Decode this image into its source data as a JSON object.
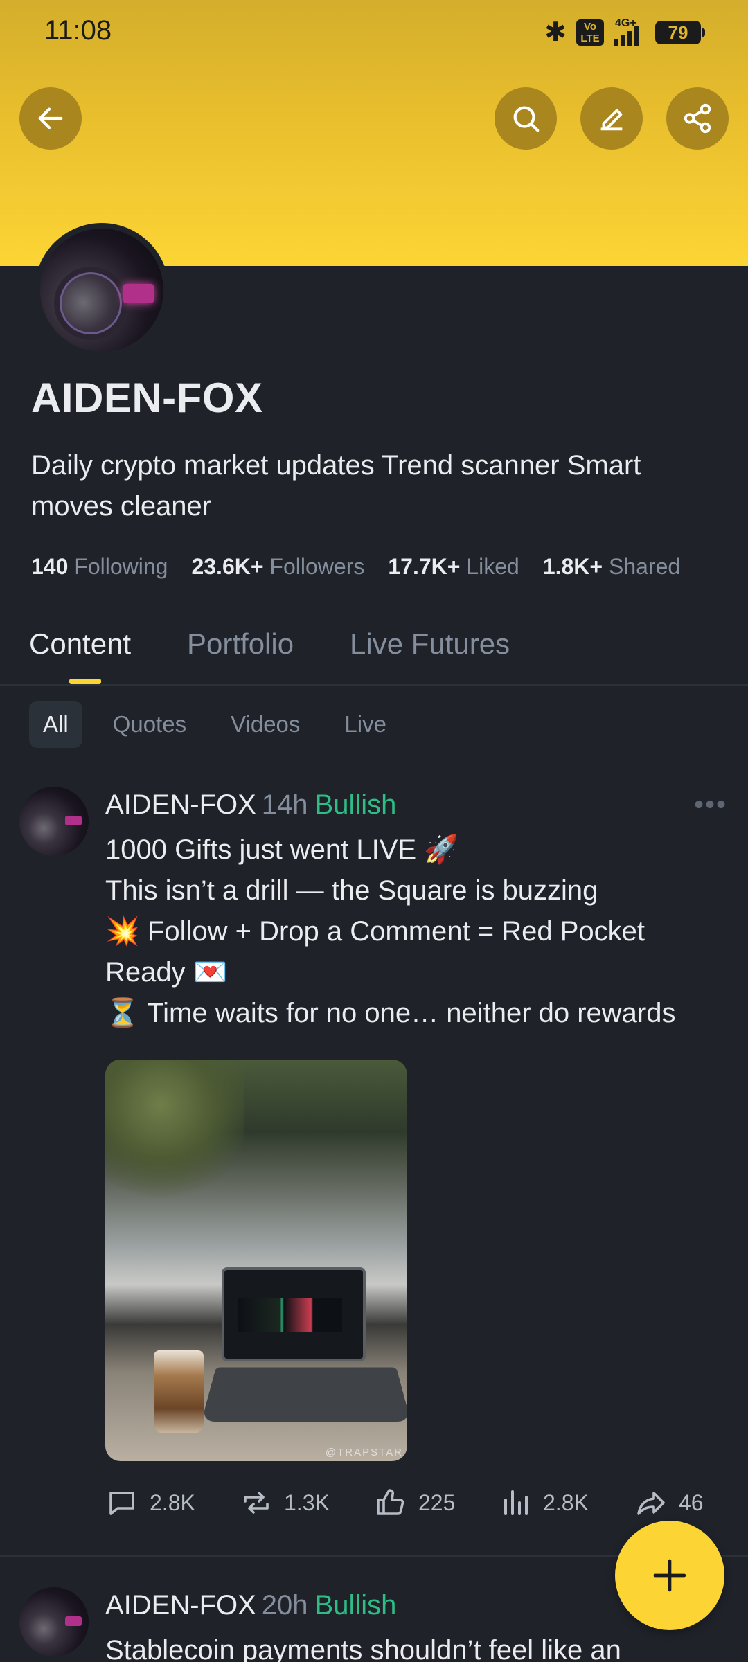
{
  "status_bar": {
    "time": "11:08",
    "network_type": "4G+",
    "volte_label": "Vo LTE",
    "battery": "79"
  },
  "header": {
    "back_icon": "arrow-left-icon",
    "search_icon": "search-icon",
    "edit_icon": "pencil-icon",
    "share_icon": "share-icon",
    "accent_color": "#fcd535"
  },
  "profile": {
    "name": "AIDEN-FOX",
    "bio": "Daily crypto market updates Trend scanner Smart moves cleaner",
    "stats": [
      {
        "value": "140",
        "label": "Following"
      },
      {
        "value": "23.6K+",
        "label": "Followers"
      },
      {
        "value": "17.7K+",
        "label": "Liked"
      },
      {
        "value": "1.8K+",
        "label": "Shared"
      }
    ]
  },
  "tabs": [
    {
      "label": "Content",
      "active": true
    },
    {
      "label": "Portfolio",
      "active": false
    },
    {
      "label": "Live Futures",
      "active": false
    }
  ],
  "filters": [
    {
      "label": "All",
      "active": true
    },
    {
      "label": "Quotes",
      "active": false
    },
    {
      "label": "Videos",
      "active": false
    },
    {
      "label": "Live",
      "active": false
    }
  ],
  "posts": [
    {
      "author": "AIDEN-FOX",
      "ago": "14h",
      "sentiment": "Bullish",
      "sentiment_color": "#2ebd85",
      "lines": [
        "1000 Gifts just went LIVE 🚀",
        "This isn’t a drill — the Square is buzzing",
        "💥 Follow + Drop a Comment = Red Pocket",
        " Ready 💌",
        "⏳ Time waits for no one… neither do rewards"
      ],
      "image_watermark": "@TRAPSTAR",
      "actions": {
        "comments": "2.8K",
        "reposts": "1.3K",
        "likes": "225",
        "views": "2.8K",
        "shares": "46"
      }
    },
    {
      "author": "AIDEN-FOX",
      "ago": "20h",
      "sentiment": "Bullish",
      "sentiment_color": "#2ebd85",
      "lines": [
        "Stablecoin payments shouldn’t feel like an"
      ]
    }
  ],
  "fab": {
    "icon": "plus-icon"
  }
}
